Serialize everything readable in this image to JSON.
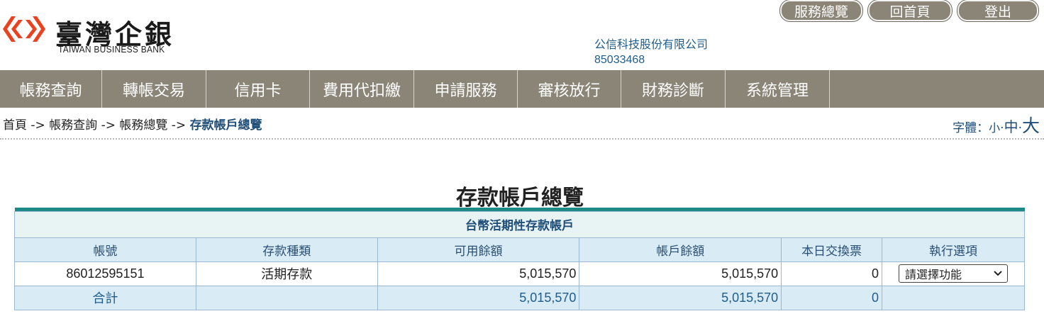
{
  "brand": {
    "name_zh": "臺灣企銀",
    "name_en": "TAIWAN BUSINESS BANK"
  },
  "top_buttons": {
    "overview": "服務總覽",
    "home": "回首頁",
    "logout": "登出"
  },
  "company": {
    "name": "公信科技股份有限公司",
    "id": "85033468"
  },
  "nav": [
    "帳務查詢",
    "轉帳交易",
    "信用卡",
    "費用代扣繳",
    "申請服務",
    "審核放行",
    "財務診斷",
    "系統管理"
  ],
  "breadcrumb": {
    "home": "首頁",
    "sep": " -> ",
    "l1": "帳務查詢",
    "l2": "帳務總覽",
    "current": "存款帳戶總覽"
  },
  "font_size": {
    "label": "字體：",
    "small": "小",
    "medium": "中",
    "large": "大",
    "dot": "·"
  },
  "page_title": "存款帳戶總覽",
  "table": {
    "caption": "台幣活期性存款帳戶",
    "headers": [
      "帳號",
      "存款種類",
      "可用餘額",
      "帳戶餘額",
      "本日交換票",
      "執行選項"
    ],
    "rows": [
      {
        "account": "86012595151",
        "type": "活期存款",
        "available": "5,015,570",
        "balance": "5,015,570",
        "clearing": "0",
        "action": "請選擇功能"
      }
    ],
    "total": {
      "label": "合計",
      "available": "5,015,570",
      "balance": "5,015,570",
      "clearing": "0"
    }
  },
  "colors": {
    "nav_bg": "#8a8577",
    "accent_teal": "#1f8a85",
    "header_blue": "#d9ecf6",
    "link_blue": "#1f4e79",
    "logo_red": "#e8421e"
  }
}
